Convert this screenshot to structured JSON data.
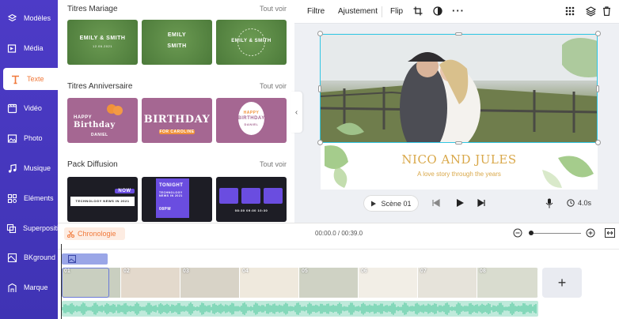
{
  "sidebar": {
    "items": [
      {
        "label": "Modèles",
        "icon": "templates-icon"
      },
      {
        "label": "Média",
        "icon": "media-icon"
      },
      {
        "label": "Texte",
        "icon": "text-icon",
        "active": true
      },
      {
        "label": "Vidéo",
        "icon": "video-icon"
      },
      {
        "label": "Photo",
        "icon": "photo-icon"
      },
      {
        "label": "Musique",
        "icon": "music-icon"
      },
      {
        "label": "Eléments",
        "icon": "elements-icon"
      },
      {
        "label": "Superpositi...",
        "icon": "overlay-icon"
      },
      {
        "label": "BKground",
        "icon": "background-icon"
      },
      {
        "label": "Marque",
        "icon": "brand-icon"
      }
    ]
  },
  "panel": {
    "sections": [
      {
        "title": "Titres Mariage",
        "see_all": "Tout voir",
        "thumbs": [
          {
            "line1": "EMILY & SMITH",
            "line2": "12.06.2021"
          },
          {
            "line1": "EMILY",
            "line2": "SMITH"
          },
          {
            "line1": "EMILY & SMITH",
            "line2": ""
          }
        ]
      },
      {
        "title": "Titres Anniversaire",
        "see_all": "Tout voir",
        "thumbs": [
          {
            "line1": "HAPPY",
            "line2": "Birthday",
            "line3": "DANIEL"
          },
          {
            "line1": "BIRTHDAY",
            "line2": "FOR CAROLINE",
            "line3": ""
          },
          {
            "line1": "HAPPY",
            "line2": "BIRTHDAY",
            "line3": "DANIEL"
          }
        ]
      },
      {
        "title": "Pack Diffusion",
        "see_all": "Tout voir",
        "thumbs": [
          {
            "line1": "NOW",
            "line2": "TECHNOLOGY NEWS IN 2021"
          },
          {
            "line1": "TONIGHT",
            "line2": "TECHNOLOGY NEWS IN 2021",
            "line3": "08PM"
          },
          {
            "line1": "",
            "line2": "08:30  09:30  10:30"
          }
        ]
      }
    ]
  },
  "toolbar": {
    "filter": "Filtre",
    "adjust": "Ajustement",
    "flip": "Flip"
  },
  "stage": {
    "title": "NICO AND JULES",
    "subtitle": "A love story through the years"
  },
  "player": {
    "scene": "Scène 01",
    "duration": "4.0s"
  },
  "timeline": {
    "label": "Chronologie",
    "time": "00:00.0 / 00:39.0",
    "clips": [
      "01",
      "02",
      "03",
      "04",
      "05",
      "06",
      "07",
      "08"
    ],
    "add_label": "+"
  },
  "colors": {
    "sidebar": "#4d3bc7",
    "accent": "#f0793a",
    "selection": "#31c6e4",
    "title_gold": "#d9a84a"
  }
}
